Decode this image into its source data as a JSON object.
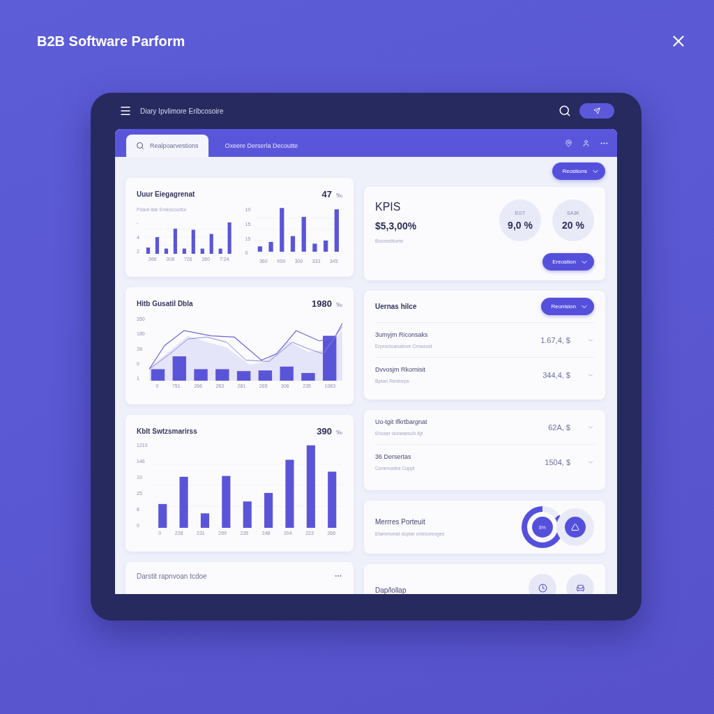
{
  "header": {
    "title": "B2B Software Parform"
  },
  "app_bar": {
    "title": "Diary Ipvlimore Eribcosoire"
  },
  "tabs": [
    {
      "label": "Realpoarvestions",
      "selected": true
    },
    {
      "label": "Oxeere Derserla Decoutte",
      "selected": false
    }
  ],
  "filter_button": "Reostions",
  "engagement": {
    "title": "Uuur Eiegagrenat",
    "value": "47",
    "unit": "‰",
    "subtitle": "Pdant lsle Enlescoutlor",
    "chart_a": {
      "y_labels": [
        "-",
        "4",
        "2"
      ],
      "x_labels": [
        "366",
        "308",
        "726",
        "260",
        "7:24"
      ]
    },
    "chart_b": {
      "y_labels": [
        "10",
        "15",
        "15",
        "0"
      ],
      "x_labels": [
        "360",
        "X00",
        "300",
        "333",
        "345"
      ]
    }
  },
  "trend": {
    "title": "Hitb Gusatil Dbla",
    "value": "1980",
    "unit": "‰",
    "y_labels": [
      "350",
      "180",
      "28",
      "0",
      "1"
    ],
    "x_labels": [
      "0",
      "751",
      "266",
      "283",
      "281",
      "265",
      "306",
      "235",
      "1083"
    ]
  },
  "summary": {
    "title": "Kblt Swtzsmarirss",
    "value": "390",
    "unit": "‰",
    "y_labels": [
      "1210",
      "146",
      "10",
      "25",
      "8",
      "0"
    ],
    "x_labels": [
      "0",
      "228",
      "231",
      "269",
      "235",
      "248",
      "204",
      "223",
      "266"
    ]
  },
  "report": {
    "title": "Darstit rapnvoan tcdoe"
  },
  "kpi": {
    "title": "KPIS",
    "value": "$5,3,00%",
    "caption": "Booxeditums",
    "button": "Ereostion",
    "circles": [
      {
        "label": "EGT",
        "value": "9,0 %"
      },
      {
        "label": "SA3K",
        "value": "20 %"
      }
    ]
  },
  "list_a": {
    "title": "Uernas hilce",
    "button": "Reonision",
    "rows": [
      {
        "title": "3umyjm Riconsaks",
        "subtitle": "Erproctoanatove Crnaoost",
        "amount": "1.67,4, $"
      },
      {
        "title": "Dvvosjm Rkornisit",
        "subtitle": "Bptan Rentorps",
        "amount": "344,4, $"
      }
    ]
  },
  "list_b": {
    "rows": [
      {
        "title": "Uo-tgit Ifkrtbargnat",
        "subtitle": "Ehoser donwarsoh Ajf",
        "amount": "62A, $"
      },
      {
        "title": "36 Dersertas",
        "subtitle": "Cenenostra Coppt",
        "amount": "1504, $"
      }
    ]
  },
  "progress": {
    "title": "Merrres Porteuit",
    "subtitle": "Elammonat doplar ontrcoreoges",
    "gauge_label": "8%"
  },
  "display": {
    "title": "Dap/lollap"
  }
}
